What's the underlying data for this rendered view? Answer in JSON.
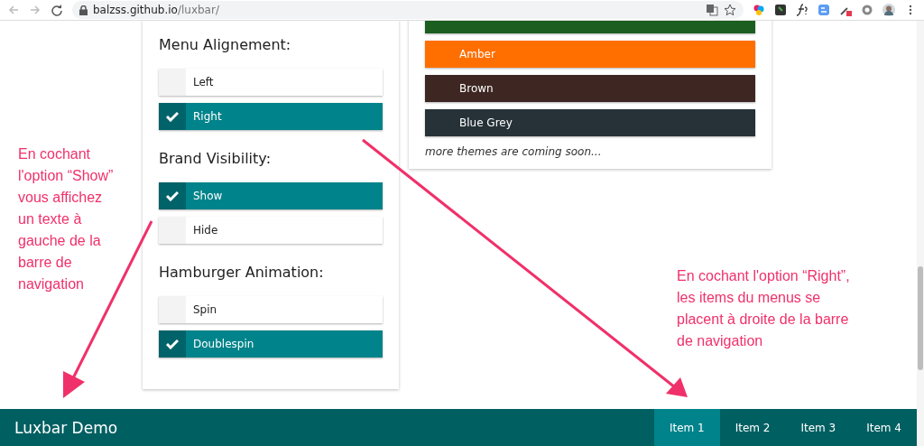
{
  "browser": {
    "url_host": "balzss.github.io",
    "url_path": "/luxbar/"
  },
  "sections": [
    {
      "title": "Menu Alignement:",
      "options": [
        {
          "label": "Left",
          "selected": false
        },
        {
          "label": "Right",
          "selected": true
        }
      ]
    },
    {
      "title": "Brand Visibility:",
      "options": [
        {
          "label": "Show",
          "selected": true
        },
        {
          "label": "Hide",
          "selected": false
        }
      ]
    },
    {
      "title": "Hamburger Animation:",
      "options": [
        {
          "label": "Spin",
          "selected": false
        },
        {
          "label": "Doublespin",
          "selected": true
        }
      ]
    }
  ],
  "themes": [
    {
      "color": "#1b5e20"
    },
    {
      "label": "Amber",
      "color": "#ff6f00"
    },
    {
      "label": "Brown",
      "color": "#3e2723"
    },
    {
      "label": "Blue Grey",
      "color": "#263238"
    }
  ],
  "themes_note": "more themes are coming soon...",
  "annotations": [
    {
      "text": "En cochant l'option “Show” vous affichez un texte à gauche de la barre de navigation"
    },
    {
      "text": "En cochant l'option “Right”, les items du menus se placent à droite de la barre de navigation"
    }
  ],
  "navbar": {
    "brand": "Luxbar Demo",
    "items": [
      {
        "label": "Item 1",
        "selected": true
      },
      {
        "label": "Item 2",
        "selected": false
      },
      {
        "label": "Item 3",
        "selected": false
      },
      {
        "label": "Item 4",
        "selected": false
      }
    ]
  }
}
